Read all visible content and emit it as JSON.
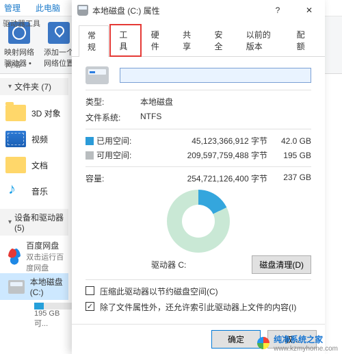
{
  "explorer": {
    "ribbon_tabs": {
      "manage": "管理",
      "this_pc": "此电脑"
    },
    "ribbon_section": "驱动器工具",
    "ribbon_group1_line1": "映射网络",
    "ribbon_group1_line2": "驱动器 •",
    "ribbon_group2_line1": "添加一个",
    "ribbon_group2_line2": "网络位置",
    "ribbon_group_label": "网络",
    "folders_header": "文件夹 (7)",
    "item_3d": "3D 对象",
    "item_video": "视频",
    "item_doc": "文档",
    "item_music": "音乐",
    "devices_header": "设备和驱动器 (5)",
    "baidu_label": "百度网盘",
    "baidu_sub": "双击运行百度网盘",
    "drive_c_label": "本地磁盘 (C:)",
    "drive_c_sub": "195 GB 可..."
  },
  "dialog": {
    "title": "本地磁盘 (C:) 属性",
    "tabs": {
      "general": "常规",
      "tools": "工具",
      "hardware": "硬件",
      "sharing": "共享",
      "security": "安全",
      "prev": "以前的版本",
      "quota": "配额"
    },
    "name_value": "",
    "type_label": "类型:",
    "type_value": "本地磁盘",
    "fs_label": "文件系统:",
    "fs_value": "NTFS",
    "used_label": "已用空间:",
    "used_bytes": "45,123,366,912 字节",
    "used_gb": "42.0 GB",
    "free_label": "可用空间:",
    "free_bytes": "209,597,759,488 字节",
    "free_gb": "195 GB",
    "capacity_label": "容量:",
    "capacity_bytes": "254,721,126,400 字节",
    "capacity_gb": "237 GB",
    "drive_caption": "驱动器 C:",
    "cleanup_btn": "磁盘清理(D)",
    "compress_chk": "压缩此驱动器以节约磁盘空间(C)",
    "index_chk": "除了文件属性外，还允许索引此驱动器上文件的内容(I)",
    "ok_btn": "确定",
    "cancel_btn": "取..."
  },
  "watermark": {
    "brand": "纯净系统之家",
    "url": "www.kzmyhome.com"
  },
  "chart_data": {
    "type": "pie",
    "title": "驱动器 C:",
    "series": [
      {
        "name": "已用空间",
        "value": 45123366912,
        "display": "42.0 GB",
        "color": "#34a6dd"
      },
      {
        "name": "可用空间",
        "value": 209597759488,
        "display": "195 GB",
        "color": "#c9e8d5"
      }
    ],
    "total": {
      "name": "容量",
      "value": 254721126400,
      "display": "237 GB"
    }
  }
}
